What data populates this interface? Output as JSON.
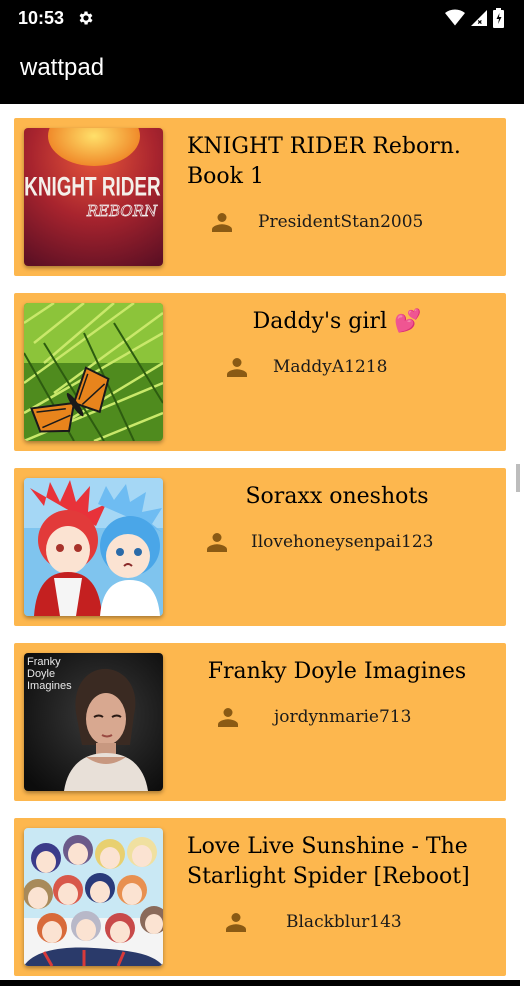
{
  "status_bar": {
    "time": "10:53",
    "icons": [
      "gear-icon",
      "wifi-icon",
      "signal-icon",
      "battery-icon"
    ]
  },
  "app_bar": {
    "title": "wattpad"
  },
  "accent_color": "#fdb74e",
  "stories": [
    {
      "title": "KNIGHT RIDER  Reborn. Book 1",
      "author": "PresidentStan2005",
      "cover": {
        "line1": "KNIGHT RIDER",
        "line2": "REBORN"
      }
    },
    {
      "title": "Daddy's girl 💕",
      "author": "MaddyA1218",
      "cover": {}
    },
    {
      "title": "Soraxx oneshots",
      "author": "Ilovehoneysenpai123",
      "cover": {}
    },
    {
      "title": "Franky Doyle Imagines",
      "author": "jordynmarie713",
      "cover": {
        "line1": "Franky",
        "line2": "Doyle",
        "line3": "Imagines"
      }
    },
    {
      "title": "Love Live Sunshine - The Starlight Spider [Reboot]",
      "author": "Blackblur143",
      "cover": {}
    }
  ]
}
